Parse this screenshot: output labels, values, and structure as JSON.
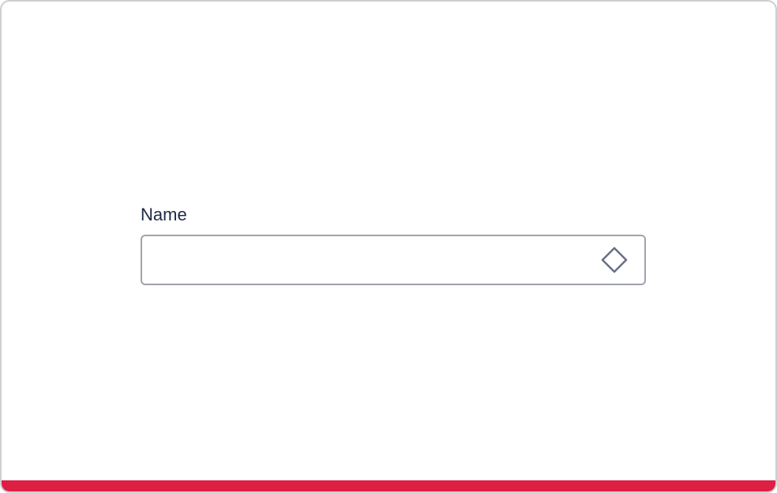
{
  "form": {
    "name_field": {
      "label": "Name",
      "value": "",
      "placeholder": "",
      "icon": "diamond-icon"
    }
  },
  "colors": {
    "accent": "#dc1f42",
    "label_text": "#1b2a45",
    "input_border": "#9fa3ad",
    "icon": "#6a7186"
  }
}
